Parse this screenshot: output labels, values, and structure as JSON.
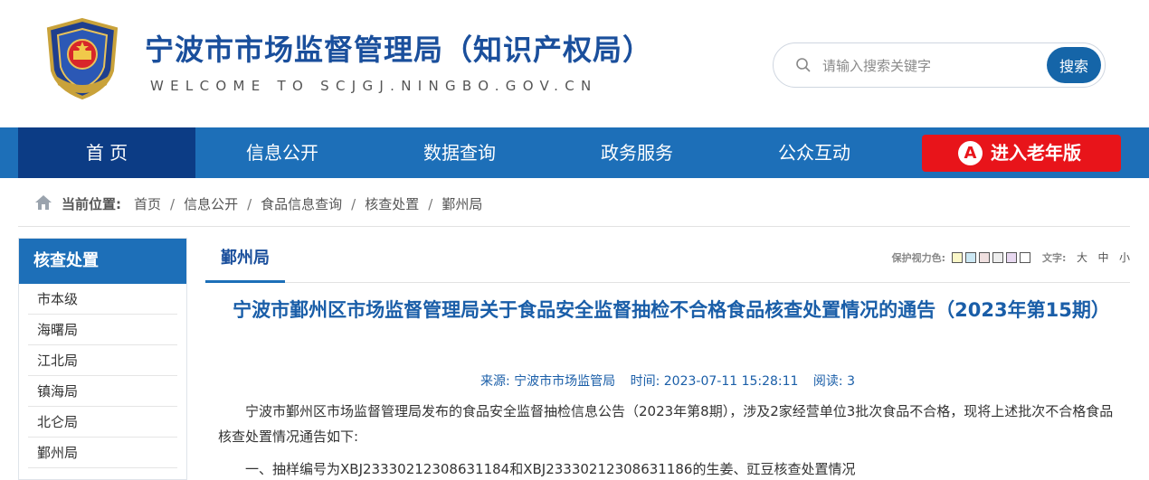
{
  "header": {
    "site_title": "宁波市市场监督管理局（知识产权局）",
    "site_subtitle": "WELCOME TO SCJGJ.NINGBO.GOV.CN",
    "search": {
      "placeholder": "请输入搜索关键字",
      "button_label": "搜索"
    }
  },
  "nav": {
    "items": [
      {
        "label": "首 页"
      },
      {
        "label": "信息公开"
      },
      {
        "label": "数据查询"
      },
      {
        "label": "政务服务"
      },
      {
        "label": "公众互动"
      }
    ],
    "elder_mode": {
      "icon_letter": "A",
      "label": "进入老年版"
    }
  },
  "breadcrumb": {
    "label": "当前位置:",
    "items": [
      "首页",
      "信息公开",
      "食品信息查询",
      "核查处置",
      "鄞州局"
    ],
    "separator": "/"
  },
  "sidebar": {
    "title": "核查处置",
    "items": [
      "市本级",
      "海曙局",
      "江北局",
      "镇海局",
      "北仑局",
      "鄞州局"
    ]
  },
  "content": {
    "tab_title": "鄞州局",
    "tools": {
      "eye_label": "保护视力色:",
      "swatch_colors": [
        "#faf7c8",
        "#cce8f4",
        "#f0e0e0",
        "#eeeeee",
        "#e8d8f0",
        "#ffffff"
      ],
      "text_label": "文字:",
      "sizes": [
        "大",
        "中",
        "小"
      ]
    },
    "article": {
      "title": "宁波市鄞州区市场监督管理局关于食品安全监督抽检不合格食品核查处置情况的通告（2023年第15期）",
      "source": "来源:  宁波市市场监管局",
      "time": "时间:  2023-07-11 15:28:11",
      "reads": "阅读:  3",
      "paragraph1": "宁波市鄞州区市场监督管理局发布的食品安全监督抽检信息公告（2023年第8期），涉及2家经营单位3批次食品不合格，现将上述批次不合格食品核查处置情况通告如下:",
      "paragraph2": "一、抽样编号为XBJ23330212308631184和XBJ23330212308631186的生姜、豇豆核查处置情况"
    }
  }
}
